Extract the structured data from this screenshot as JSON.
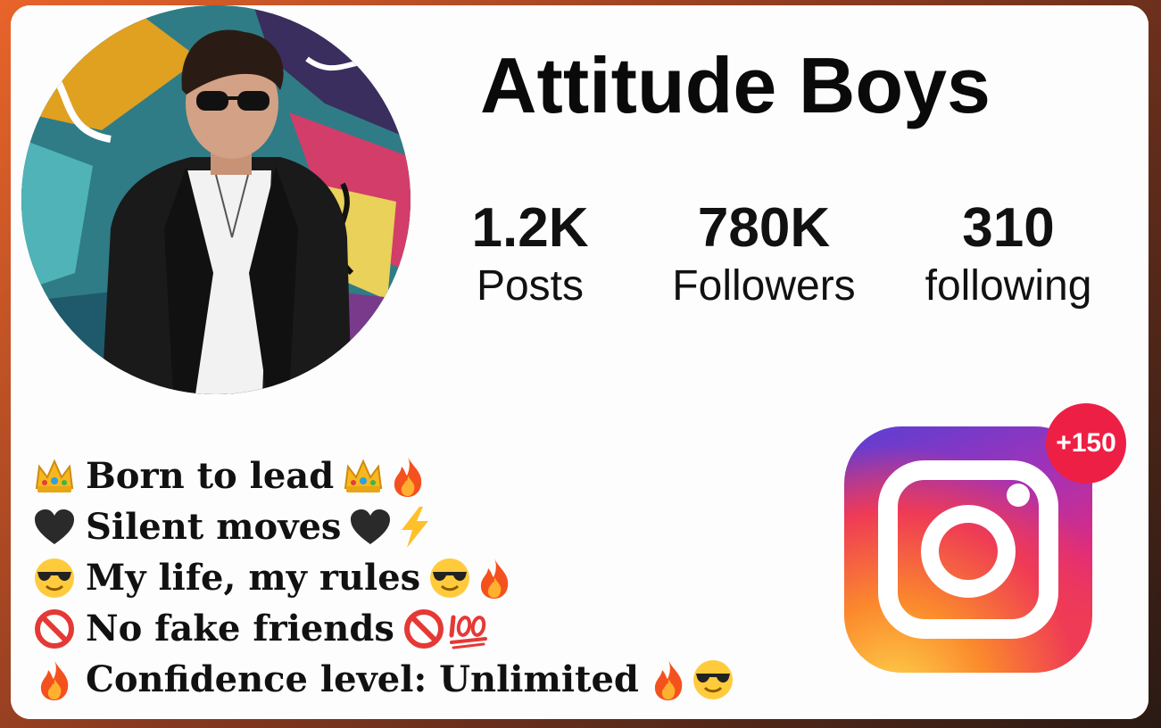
{
  "profile": {
    "name": "Attitude Boys",
    "avatar_icon": "profile-photo",
    "stats": [
      {
        "value": "1.2K",
        "label": "Posts"
      },
      {
        "value": "780K",
        "label": "Followers"
      },
      {
        "value": "310",
        "label": "following"
      }
    ]
  },
  "bio": [
    {
      "lead": "crown-emoji",
      "text": "Born to lead",
      "trail": [
        "crown-emoji",
        "fire-emoji"
      ]
    },
    {
      "lead": "black-heart-emoji",
      "text": "Silent moves",
      "trail": [
        "black-heart-emoji",
        "lightning-emoji"
      ]
    },
    {
      "lead": "sunglasses-emoji",
      "text": "My life, my rules",
      "trail": [
        "sunglasses-emoji",
        "fire-emoji"
      ]
    },
    {
      "lead": "no-entry-emoji",
      "text": "No fake friends",
      "trail": [
        "no-entry-emoji",
        "hundred-emoji"
      ]
    },
    {
      "lead": "fire-emoji",
      "text": "Confidence level: Unlimited",
      "trail": [
        "fire-emoji",
        "sunglasses-emoji"
      ]
    }
  ],
  "instagram": {
    "icon": "instagram-logo-icon",
    "notification_badge": "+150",
    "colors": {
      "badge": "#ee1f45",
      "purple": "#5a3fd4",
      "pink": "#e12b7a",
      "orange": "#fb8a2c",
      "yellow": "#fdd54d"
    }
  }
}
